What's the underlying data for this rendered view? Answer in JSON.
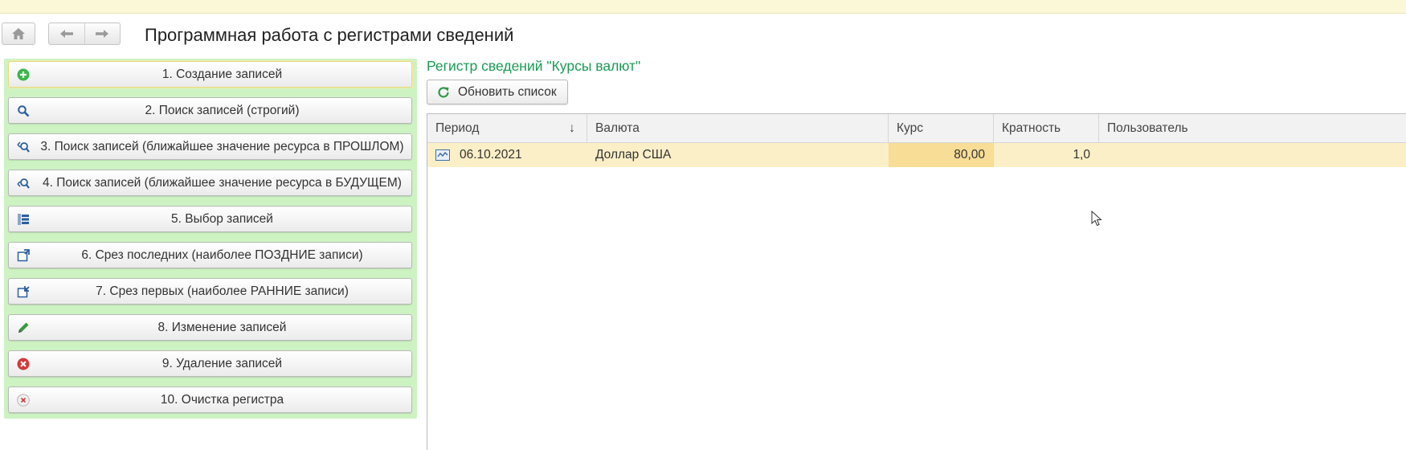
{
  "window": {
    "title": "Программная работа с регистрами сведений"
  },
  "nav": {
    "home_icon": "home-icon",
    "back_icon": "arrow-left-icon",
    "forward_icon": "arrow-right-icon"
  },
  "commands": [
    {
      "label": "1. Создание записей",
      "icon": "plus-circle-icon"
    },
    {
      "label": "2. Поиск записей (строгий)",
      "icon": "search-icon"
    },
    {
      "label": "3. Поиск записей (ближайшее значение ресурса в ПРОШЛОМ)",
      "icon": "search-back-icon"
    },
    {
      "label": "4. Поиск записей (ближайшее значение ресурса в БУДУЩЕМ)",
      "icon": "search-forward-icon"
    },
    {
      "label": "5. Выбор записей",
      "icon": "list-select-icon"
    },
    {
      "label": "6. Срез последних (наиболее ПОЗДНИЕ записи)",
      "icon": "slice-last-icon"
    },
    {
      "label": "7. Срез первых (наиболее РАННИЕ записи)",
      "icon": "slice-first-icon"
    },
    {
      "label": "8. Изменение записей",
      "icon": "pencil-icon"
    },
    {
      "label": "9. Удаление записей",
      "icon": "delete-red-icon"
    },
    {
      "label": "10. Очистка регистра",
      "icon": "clear-icon"
    }
  ],
  "register": {
    "title": "Регистр сведений \"Курсы валют\"",
    "refresh_label": "Обновить список",
    "columns": [
      "Период",
      "Валюта",
      "Курс",
      "Кратность",
      "Пользователь"
    ],
    "sort_indicator": "↓",
    "rows": [
      {
        "period": "06.10.2021",
        "currency": "Доллар США",
        "rate": "80,00",
        "multiplicity": "1,0",
        "user": ""
      }
    ]
  },
  "colors": {
    "accent_green": "#1a9a54",
    "panel_green": "#cdf3c3",
    "row_selected": "#fbefc7",
    "cell_highlight": "#f7dd95",
    "top_strip": "#fbf8d8"
  }
}
